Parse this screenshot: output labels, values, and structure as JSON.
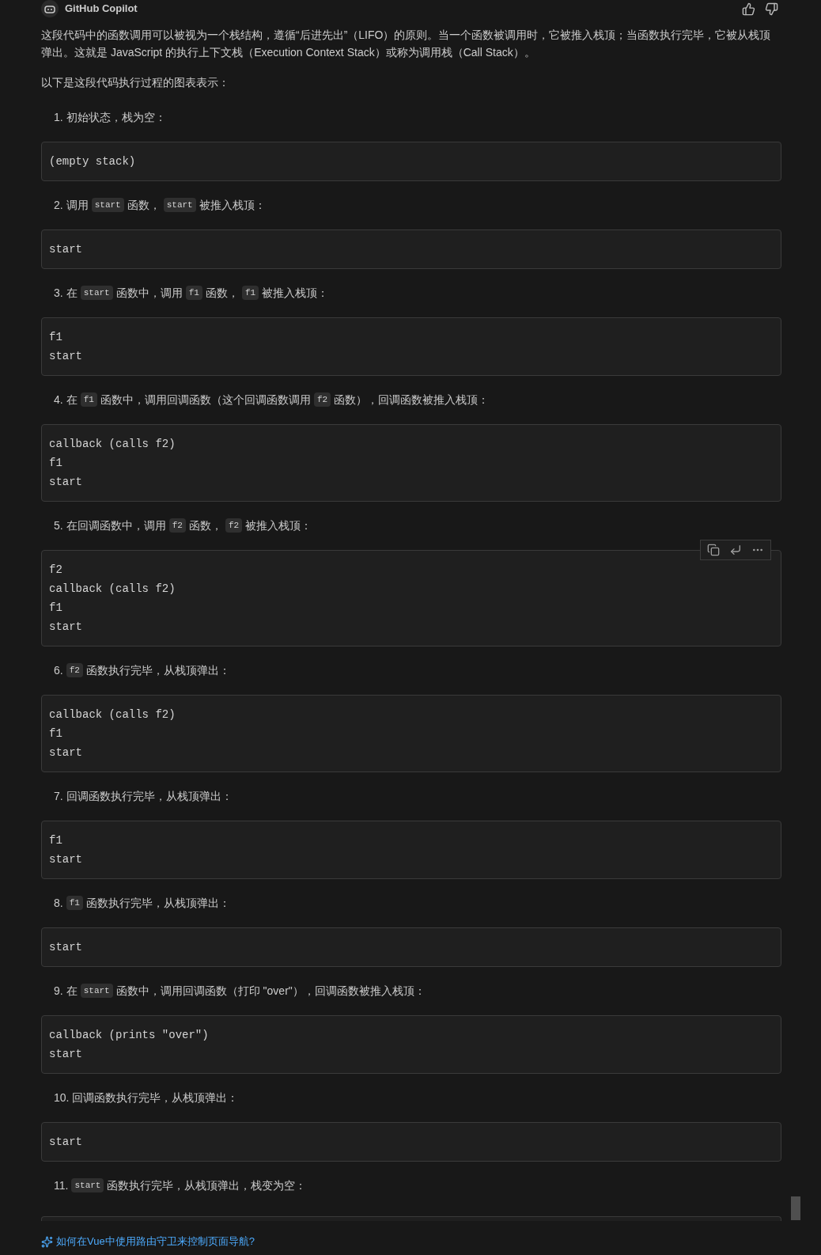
{
  "header": {
    "title": "GitHub Copilot"
  },
  "intro": "这段代码中的函数调用可以被视为一个栈结构，遵循“后进先出”（LIFO）的原则。当一个函数被调用时，它被推入栈顶；当函数执行完毕，它被从栈顶弹出。这就是 JavaScript 的执行上下文栈（Execution Context Stack）或称为调用栈（Call Stack）。",
  "lead": "以下是这段代码执行过程的图表表示：",
  "steps": [
    {
      "number": "1.",
      "parts": [
        {
          "kind": "text",
          "text": "初始状态，栈为空："
        }
      ],
      "code_lines": [
        "(empty stack)"
      ],
      "hovered": false
    },
    {
      "number": "2.",
      "parts": [
        {
          "kind": "text",
          "text": "调用"
        },
        {
          "kind": "code",
          "text": "start"
        },
        {
          "kind": "text",
          "text": "函数，"
        },
        {
          "kind": "code",
          "text": "start"
        },
        {
          "kind": "text",
          "text": "被推入栈顶："
        }
      ],
      "code_lines": [
        "start"
      ],
      "hovered": false
    },
    {
      "number": "3.",
      "parts": [
        {
          "kind": "text",
          "text": "在"
        },
        {
          "kind": "code",
          "text": "start"
        },
        {
          "kind": "text",
          "text": "函数中，调用"
        },
        {
          "kind": "code",
          "text": "f1"
        },
        {
          "kind": "text",
          "text": "函数，"
        },
        {
          "kind": "code",
          "text": "f1"
        },
        {
          "kind": "text",
          "text": "被推入栈顶："
        }
      ],
      "code_lines": [
        "f1",
        "start"
      ],
      "hovered": false
    },
    {
      "number": "4.",
      "parts": [
        {
          "kind": "text",
          "text": "在"
        },
        {
          "kind": "code",
          "text": "f1"
        },
        {
          "kind": "text",
          "text": "函数中，调用回调函数（这个回调函数调用"
        },
        {
          "kind": "code",
          "text": "f2"
        },
        {
          "kind": "text",
          "text": "函数），回调函数被推入栈顶："
        }
      ],
      "code_lines": [
        "callback (calls f2)",
        "f1",
        "start"
      ],
      "hovered": false
    },
    {
      "number": "5.",
      "parts": [
        {
          "kind": "text",
          "text": "在回调函数中，调用"
        },
        {
          "kind": "code",
          "text": "f2"
        },
        {
          "kind": "text",
          "text": "函数，"
        },
        {
          "kind": "code",
          "text": "f2"
        },
        {
          "kind": "text",
          "text": "被推入栈顶："
        }
      ],
      "code_lines": [
        "f2",
        "callback (calls f2)",
        "f1",
        "start"
      ],
      "hovered": true
    },
    {
      "number": "6.",
      "parts": [
        {
          "kind": "code",
          "text": "f2"
        },
        {
          "kind": "text",
          "text": "函数执行完毕，从栈顶弹出："
        }
      ],
      "code_lines": [
        "callback (calls f2)",
        "f1",
        "start"
      ],
      "hovered": false
    },
    {
      "number": "7.",
      "parts": [
        {
          "kind": "text",
          "text": "回调函数执行完毕，从栈顶弹出："
        }
      ],
      "code_lines": [
        "f1",
        "start"
      ],
      "hovered": false
    },
    {
      "number": "8.",
      "parts": [
        {
          "kind": "code",
          "text": "f1"
        },
        {
          "kind": "text",
          "text": "函数执行完毕，从栈顶弹出："
        }
      ],
      "code_lines": [
        "start"
      ],
      "hovered": false
    },
    {
      "number": "9.",
      "parts": [
        {
          "kind": "text",
          "text": "在"
        },
        {
          "kind": "code",
          "text": "start"
        },
        {
          "kind": "text",
          "text": "函数中，调用回调函数（打印 \"over\"），回调函数被推入栈顶："
        }
      ],
      "code_lines": [
        "callback (prints \"over\")",
        "start"
      ],
      "hovered": false
    },
    {
      "number": "10.",
      "parts": [
        {
          "kind": "text",
          "text": "回调函数执行完毕，从栈顶弹出："
        }
      ],
      "code_lines": [
        "start"
      ],
      "hovered": false
    },
    {
      "number": "11.",
      "parts": [
        {
          "kind": "code",
          "text": "start"
        },
        {
          "kind": "text",
          "text": "函数执行完毕，从栈顶弹出，栈变为空："
        }
      ],
      "hovered": false
    }
  ],
  "footer": {
    "link": "如何在Vue中使用路由守卫来控制页面导航?"
  }
}
